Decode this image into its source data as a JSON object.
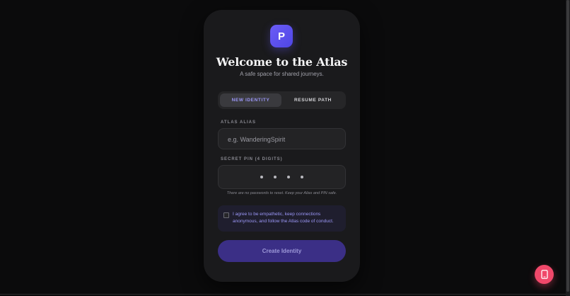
{
  "logo": {
    "letter": "P"
  },
  "header": {
    "title": "Welcome to the Atlas",
    "subtitle": "A safe space for shared journeys."
  },
  "tabs": [
    {
      "label": "NEW IDENTITY",
      "active": true
    },
    {
      "label": "RESUME PATH",
      "active": false
    }
  ],
  "alias": {
    "label": "ATLAS ALIAS",
    "placeholder": "e.g. WanderingSpirit",
    "value": ""
  },
  "pin": {
    "label": "SECRET PIN (4 DIGITS)",
    "masked": "••••"
  },
  "hint": "There are no passwords to reset. Keep your Alias and PIN safe.",
  "agreement": {
    "checked": false,
    "text": "I agree to be empathetic, keep connections anonymous, and follow the Atlas code of conduct."
  },
  "submit": {
    "label": "Create Identity"
  },
  "fab": {
    "icon": "phone-icon"
  },
  "colors": {
    "accent": "#6b5cf6",
    "button": "#3b2f86",
    "fab": "#f0486a",
    "card": "#1a1a1c",
    "background": "#0b0b0c"
  }
}
